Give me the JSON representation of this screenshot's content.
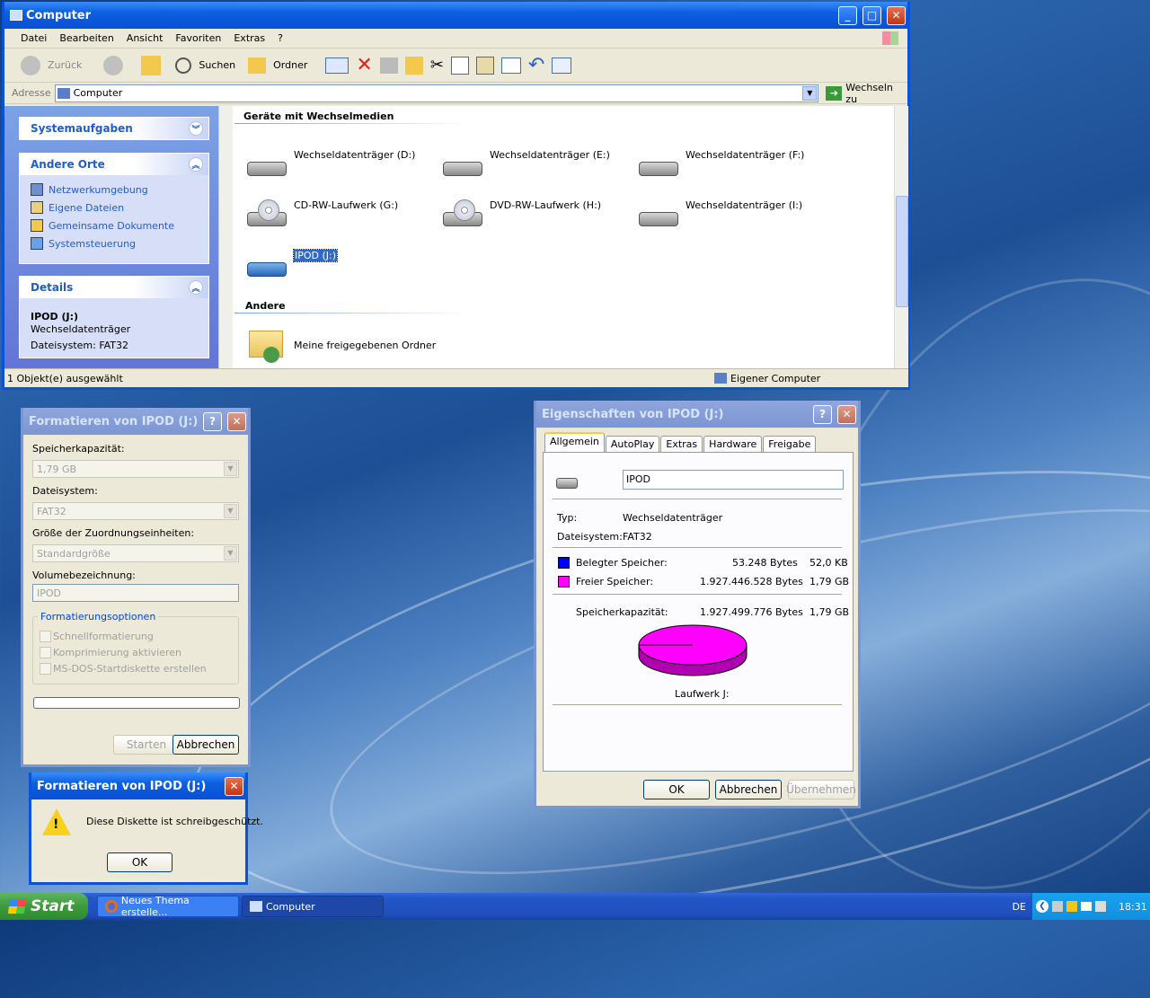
{
  "explorer": {
    "title": "Computer",
    "menu": [
      "Datei",
      "Bearbeiten",
      "Ansicht",
      "Favoriten",
      "Extras",
      "?"
    ],
    "toolbar": {
      "back": "Zurück",
      "search": "Suchen",
      "folders": "Ordner"
    },
    "address": {
      "label": "Adresse",
      "value": "Computer",
      "go": "Wechseln zu"
    },
    "sidebar": {
      "system": "Systemaufgaben",
      "other": "Andere Orte",
      "links": [
        "Netzwerkumgebung",
        "Eigene Dateien",
        "Gemeinsame Dokumente",
        "Systemsteuerung"
      ],
      "details": "Details",
      "det_name": "IPOD (J:)",
      "det_type": "Wechseldatenträger",
      "det_fs": "Dateisystem: FAT32"
    },
    "group_removable": "Geräte mit Wechselmedien",
    "drives": [
      "Wechseldatenträger (D:)",
      "Wechseldatenträger (E:)",
      "Wechseldatenträger (F:)",
      "CD-RW-Laufwerk (G:)",
      "DVD-RW-Laufwerk (H:)",
      "Wechseldatenträger (I:)",
      "IPOD (J:)"
    ],
    "group_other": "Andere",
    "shared": "Meine freigegebenen Ordner",
    "status_left": "1 Objekt(e) ausgewählt",
    "status_right": "Eigener Computer"
  },
  "format": {
    "title": "Formatieren von IPOD (J:)",
    "cap_label": "Speicherkapazität:",
    "cap": "1,79 GB",
    "fs_label": "Dateisystem:",
    "fs": "FAT32",
    "alloc_label": "Größe der Zuordnungseinheiten:",
    "alloc": "Standardgröße",
    "vol_label": "Volumebezeichnung:",
    "vol": "IPOD",
    "opts": "Formatierungsoptionen",
    "o1": "Schnellformatierung",
    "o2": "Komprimierung aktivieren",
    "o3": "MS-DOS-Startdiskette erstellen",
    "start": "Starten",
    "cancel": "Abbrechen"
  },
  "alert": {
    "title": "Formatieren von IPOD (J:)",
    "msg": "Diese Diskette ist schreibgeschützt.",
    "ok": "OK"
  },
  "props": {
    "title": "Eigenschaften von IPOD (J:)",
    "tabs": [
      "Allgemein",
      "AutoPlay",
      "Extras",
      "Hardware",
      "Freigabe"
    ],
    "name": "IPOD",
    "type_label": "Typ:",
    "type": "Wechseldatenträger",
    "fs_label": "Dateisystem:",
    "fs": "FAT32",
    "used_label": "Belegter Speicher:",
    "used_bytes": "53.248 Bytes",
    "used_h": "52,0 KB",
    "free_label": "Freier Speicher:",
    "free_bytes": "1.927.446.528 Bytes",
    "free_h": "1,79 GB",
    "cap_label": "Speicherkapazität:",
    "cap_bytes": "1.927.499.776 Bytes",
    "cap_h": "1,79 GB",
    "drive_label": "Laufwerk J:",
    "ok": "OK",
    "cancel": "Abbrechen",
    "apply": "Übernehmen",
    "used_color": "#0000ff",
    "free_color": "#ff00ff",
    "used_fraction": 2.76e-05
  },
  "taskbar": {
    "start": "Start",
    "task1": "Neues Thema erstelle...",
    "task2": "Computer",
    "lang": "DE",
    "clock": "18:31"
  }
}
